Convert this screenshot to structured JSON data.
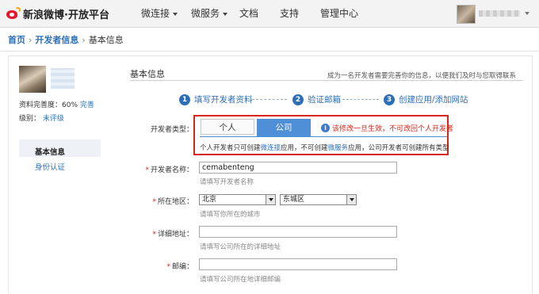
{
  "header": {
    "logo_text": "新浪微博·开放平台",
    "nav": [
      {
        "label": "微连接",
        "has_caret": true
      },
      {
        "label": "微服务",
        "has_caret": true
      },
      {
        "label": "文档",
        "has_caret": false
      },
      {
        "label": "支持",
        "has_caret": false
      },
      {
        "label": "管理中心",
        "has_caret": false
      }
    ]
  },
  "breadcrumb": {
    "home": "首页",
    "dev_info": "开发者信息",
    "current": "基本信息",
    "separator": "›"
  },
  "sidebar": {
    "completeness_label": "资料完善度：",
    "completeness_value": "60%",
    "completeness_link": "完善",
    "level_label": "级别：",
    "level_value": "未评级",
    "menu": [
      {
        "label": "基本信息",
        "active": true
      },
      {
        "label": "身份认证",
        "active": false
      }
    ]
  },
  "main": {
    "title": "基本信息",
    "hint": "成为一名开发者需要完善你的信息，以便我们及时与您取得联系",
    "steps": [
      {
        "num": "1",
        "label": "填写开发者资料"
      },
      {
        "num": "2",
        "label": "验证邮箱"
      },
      {
        "num": "3",
        "label": "创建应用/添加网站"
      }
    ],
    "dev_type": {
      "label": "开发者类型：",
      "option_person": "个人",
      "option_company": "公司",
      "selected": "公司",
      "warning": "该修改一旦生效，不可改回个人开发者",
      "desc_1": "个人开发者只可创建",
      "desc_link_1": "微连接",
      "desc_2": "应用，不可创建",
      "desc_link_2": "微服务",
      "desc_3": "应用，公司开发者可创建所有类型"
    },
    "form": {
      "developer_name": {
        "label": "开发者名称：",
        "value": "cemabenteng",
        "help": "请填写开发者名称"
      },
      "region": {
        "label": "所在地区：",
        "province": "北京",
        "district": "东城区",
        "help": "请填写你所在的城市"
      },
      "address": {
        "label": "详细地址：",
        "value": "",
        "help": "请填写公司所在的详细地址"
      },
      "postcode": {
        "label": "邮编：",
        "value": "",
        "help": "请填写公司所在地详细邮编"
      }
    }
  },
  "colors": {
    "accent": "#2c6fb7",
    "selected_tab": "#4f8fd8",
    "warning": "#d9261c"
  }
}
